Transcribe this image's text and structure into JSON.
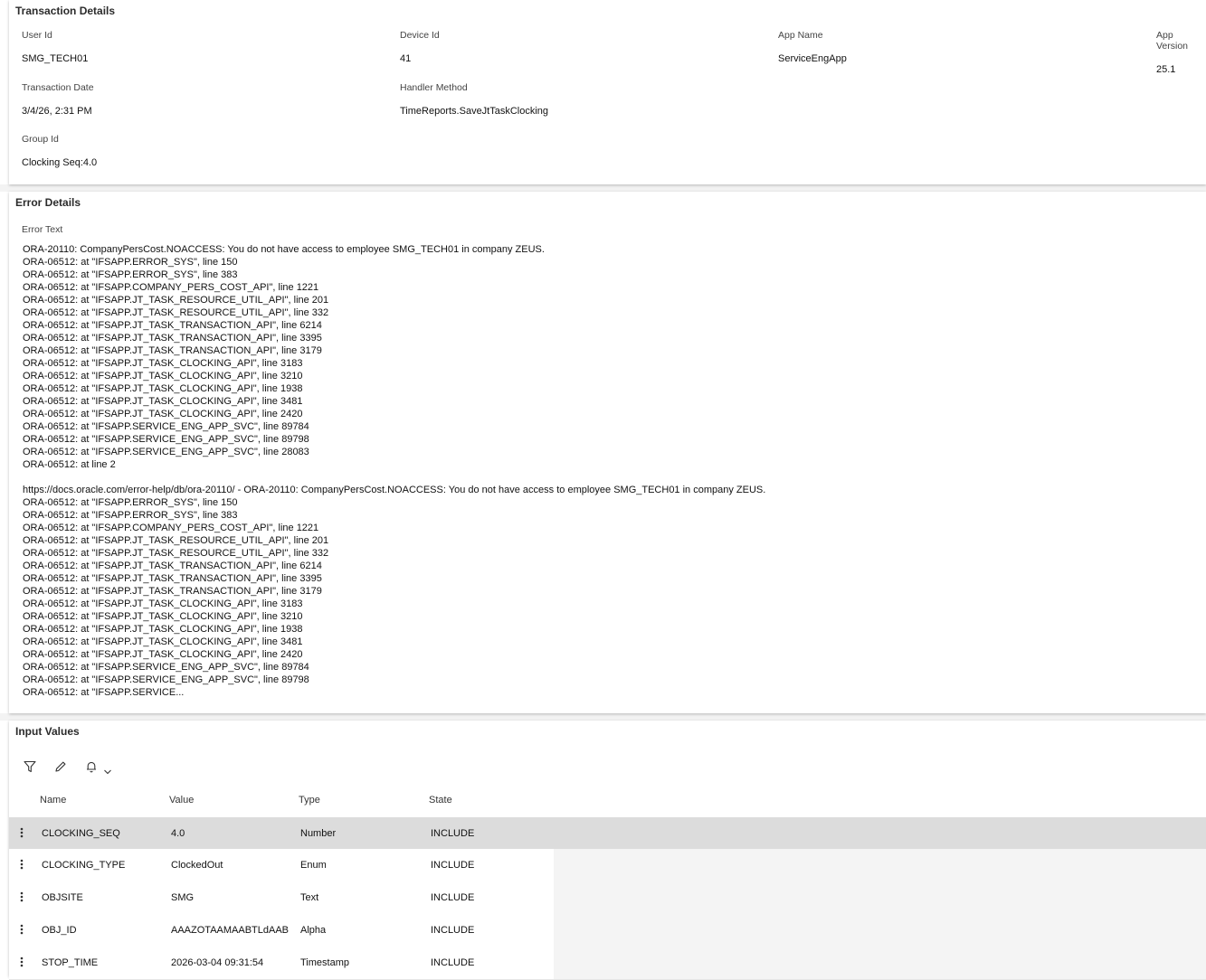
{
  "transaction": {
    "title": "Transaction Details",
    "user_id": {
      "label": "User Id",
      "value": "SMG_TECH01"
    },
    "device_id": {
      "label": "Device Id",
      "value": "41"
    },
    "app_name": {
      "label": "App Name",
      "value": "ServiceEngApp"
    },
    "app_version": {
      "label": "App Version",
      "value": "25.1"
    },
    "transaction_date": {
      "label": "Transaction Date",
      "value": "3/4/26, 2:31 PM"
    },
    "handler_method": {
      "label": "Handler Method",
      "value": "TimeReports.SaveJtTaskClocking"
    },
    "group_id": {
      "label": "Group Id",
      "value": "Clocking Seq:4.0"
    }
  },
  "error": {
    "title": "Error Details",
    "label": "Error Text",
    "text": "ORA-20110: CompanyPersCost.NOACCESS: You do not have access to employee SMG_TECH01 in company ZEUS.\nORA-06512: at \"IFSAPP.ERROR_SYS\", line 150\nORA-06512: at \"IFSAPP.ERROR_SYS\", line 383\nORA-06512: at \"IFSAPP.COMPANY_PERS_COST_API\", line 1221\nORA-06512: at \"IFSAPP.JT_TASK_RESOURCE_UTIL_API\", line 201\nORA-06512: at \"IFSAPP.JT_TASK_RESOURCE_UTIL_API\", line 332\nORA-06512: at \"IFSAPP.JT_TASK_TRANSACTION_API\", line 6214\nORA-06512: at \"IFSAPP.JT_TASK_TRANSACTION_API\", line 3395\nORA-06512: at \"IFSAPP.JT_TASK_TRANSACTION_API\", line 3179\nORA-06512: at \"IFSAPP.JT_TASK_CLOCKING_API\", line 3183\nORA-06512: at \"IFSAPP.JT_TASK_CLOCKING_API\", line 3210\nORA-06512: at \"IFSAPP.JT_TASK_CLOCKING_API\", line 1938\nORA-06512: at \"IFSAPP.JT_TASK_CLOCKING_API\", line 3481\nORA-06512: at \"IFSAPP.JT_TASK_CLOCKING_API\", line 2420\nORA-06512: at \"IFSAPP.SERVICE_ENG_APP_SVC\", line 89784\nORA-06512: at \"IFSAPP.SERVICE_ENG_APP_SVC\", line 89798\nORA-06512: at \"IFSAPP.SERVICE_ENG_APP_SVC\", line 28083\nORA-06512: at line 2\n\nhttps://docs.oracle.com/error-help/db/ora-20110/ - ORA-20110: CompanyPersCost.NOACCESS: You do not have access to employee SMG_TECH01 in company ZEUS.\nORA-06512: at \"IFSAPP.ERROR_SYS\", line 150\nORA-06512: at \"IFSAPP.ERROR_SYS\", line 383\nORA-06512: at \"IFSAPP.COMPANY_PERS_COST_API\", line 1221\nORA-06512: at \"IFSAPP.JT_TASK_RESOURCE_UTIL_API\", line 201\nORA-06512: at \"IFSAPP.JT_TASK_RESOURCE_UTIL_API\", line 332\nORA-06512: at \"IFSAPP.JT_TASK_TRANSACTION_API\", line 6214\nORA-06512: at \"IFSAPP.JT_TASK_TRANSACTION_API\", line 3395\nORA-06512: at \"IFSAPP.JT_TASK_TRANSACTION_API\", line 3179\nORA-06512: at \"IFSAPP.JT_TASK_CLOCKING_API\", line 3183\nORA-06512: at \"IFSAPP.JT_TASK_CLOCKING_API\", line 3210\nORA-06512: at \"IFSAPP.JT_TASK_CLOCKING_API\", line 1938\nORA-06512: at \"IFSAPP.JT_TASK_CLOCKING_API\", line 3481\nORA-06512: at \"IFSAPP.JT_TASK_CLOCKING_API\", line 2420\nORA-06512: at \"IFSAPP.SERVICE_ENG_APP_SVC\", line 89784\nORA-06512: at \"IFSAPP.SERVICE_ENG_APP_SVC\", line 89798\nORA-06512: at \"IFSAPP.SERVICE..."
  },
  "input_values": {
    "title": "Input Values",
    "toolbar": {
      "filter_icon": "filter-icon",
      "edit_icon": "pencil-icon",
      "notify_icon": "bell-icon",
      "dropdown_icon": "chevron-down-icon"
    },
    "columns": [
      "Name",
      "Value",
      "Type",
      "State"
    ],
    "rows": [
      {
        "name": "CLOCKING_SEQ",
        "value": "4.0",
        "type": "Number",
        "state": "INCLUDE"
      },
      {
        "name": "CLOCKING_TYPE",
        "value": "ClockedOut",
        "type": "Enum",
        "state": "INCLUDE"
      },
      {
        "name": "OBJSITE",
        "value": "SMG",
        "type": "Text",
        "state": "INCLUDE"
      },
      {
        "name": "OBJ_ID",
        "value": "AAAZOTAAMAABTLdAAB",
        "type": "Alpha",
        "state": "INCLUDE"
      },
      {
        "name": "STOP_TIME",
        "value": "2026-03-04 09:31:54",
        "type": "Timestamp",
        "state": "INCLUDE"
      }
    ]
  }
}
